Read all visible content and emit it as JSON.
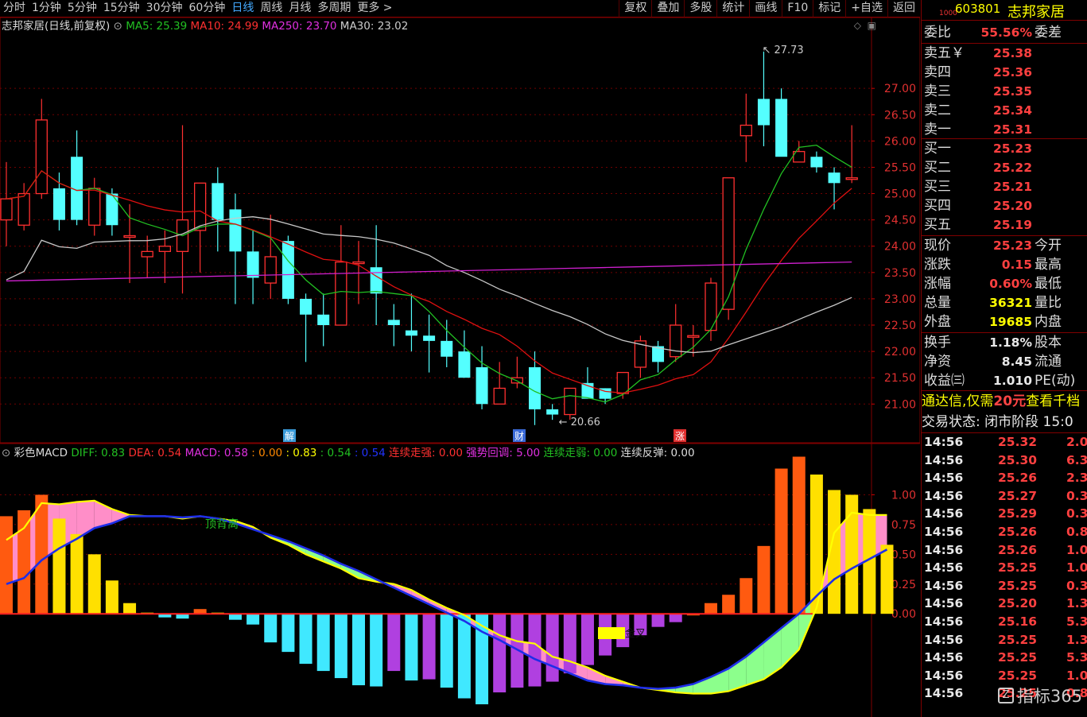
{
  "toolbar": {
    "periods": [
      "分时",
      "1分钟",
      "5分钟",
      "15分钟",
      "30分钟",
      "60分钟",
      "日线",
      "周线",
      "月线",
      "多周期",
      "更多 >"
    ],
    "active_period": "日线",
    "tools": [
      "复权",
      "叠加",
      "多股",
      "统计",
      "画线",
      "F10",
      "标记",
      "+自选",
      "返回"
    ]
  },
  "main_title": {
    "stock": "志邦家居(日线,前复权)",
    "ma5": "MA5: 25.39",
    "ma10": "MA10: 24.99",
    "ma250": "MA250: 23.70",
    "ma30": "MA30: 23.02"
  },
  "macd_title": {
    "name": "彩色MACD",
    "diff": "DIFF: 0.83",
    "dea": "DEA: 0.54",
    "macd": "MACD: 0.58",
    "v1": ": 0.00",
    "v2": ": 0.83",
    "v3": ": 0.54",
    "v4": ": 0.54",
    "s1": "连续走强: 0.00",
    "s2": "强势回调: 5.00",
    "s3": "连续走弱: 0.00",
    "s4": "连续反弹: 0.00"
  },
  "annotations": {
    "high": "27.73",
    "low": "20.66",
    "markers": [
      "解",
      "财",
      "涨"
    ],
    "divergence": "顶背离",
    "golden_cross": "低位金叉"
  },
  "colors": {
    "up": "#ff3030",
    "down": "#54ffff",
    "ma5": "#22c022",
    "ma10": "#e01010",
    "ma250": "#d020d0",
    "ma30": "#c8c8c8",
    "diff": "#ffff00",
    "dea": "#1e2ee8"
  },
  "chart_data": [
    {
      "type": "candlestick",
      "title": "志邦家居(日线,前复权)",
      "yticks": [
        21.0,
        21.5,
        22.0,
        22.5,
        23.0,
        23.5,
        24.0,
        24.5,
        25.0,
        25.5,
        26.0,
        26.5,
        27.0
      ],
      "ylim": [
        20.4,
        28.0
      ],
      "candles": [
        [
          24.5,
          24.9,
          24.0,
          25.6
        ],
        [
          24.4,
          25.0,
          24.3,
          25.2
        ],
        [
          25.0,
          26.4,
          24.9,
          26.8
        ],
        [
          25.1,
          24.5,
          24.3,
          25.4
        ],
        [
          25.7,
          24.5,
          24.4,
          26.2
        ],
        [
          24.4,
          25.1,
          24.2,
          25.3
        ],
        [
          25.0,
          24.4,
          24.2,
          25.1
        ],
        [
          24.2,
          24.2,
          23.3,
          24.8
        ],
        [
          23.8,
          23.9,
          23.4,
          24.2
        ],
        [
          23.9,
          24.0,
          23.3,
          24.3
        ],
        [
          23.9,
          24.5,
          23.1,
          26.3
        ],
        [
          24.3,
          25.2,
          23.5,
          25.2
        ],
        [
          25.2,
          24.5,
          23.9,
          25.5
        ],
        [
          24.7,
          23.9,
          22.9,
          25.0
        ],
        [
          23.9,
          23.4,
          22.9,
          24.3
        ],
        [
          23.3,
          23.8,
          23.0,
          24.6
        ],
        [
          24.1,
          23.0,
          22.9,
          24.2
        ],
        [
          23.0,
          22.7,
          21.8,
          23.1
        ],
        [
          22.7,
          22.5,
          22.1,
          23.1
        ],
        [
          22.5,
          23.7,
          22.5,
          24.4
        ],
        [
          23.7,
          23.7,
          22.9,
          24.1
        ],
        [
          23.6,
          23.1,
          22.5,
          24.4
        ],
        [
          22.6,
          22.5,
          22.1,
          22.9
        ],
        [
          22.4,
          22.3,
          22.0,
          23.1
        ],
        [
          22.3,
          22.2,
          21.6,
          22.7
        ],
        [
          22.2,
          21.9,
          21.7,
          22.6
        ],
        [
          22.0,
          21.5,
          21.5,
          22.4
        ],
        [
          21.7,
          21.0,
          20.9,
          22.1
        ],
        [
          21.0,
          21.3,
          21.1,
          21.8
        ],
        [
          21.4,
          21.5,
          21.3,
          21.9
        ],
        [
          21.7,
          20.9,
          20.6,
          22.0
        ],
        [
          20.9,
          20.8,
          20.7,
          21.0
        ],
        [
          20.8,
          21.3,
          20.7,
          21.3
        ],
        [
          21.4,
          21.1,
          21.2,
          21.7
        ],
        [
          21.3,
          21.1,
          21.0,
          21.3
        ],
        [
          21.2,
          21.6,
          21.1,
          21.6
        ],
        [
          21.7,
          22.2,
          21.5,
          22.3
        ],
        [
          22.1,
          21.8,
          21.6,
          22.2
        ],
        [
          21.9,
          22.5,
          21.8,
          22.9
        ],
        [
          22.3,
          22.3,
          21.9,
          22.5
        ],
        [
          22.4,
          23.3,
          22.2,
          23.4
        ],
        [
          22.8,
          25.3,
          22.6,
          25.3
        ],
        [
          26.1,
          26.3,
          25.6,
          26.9
        ],
        [
          26.8,
          26.3,
          25.9,
          27.7
        ],
        [
          26.8,
          25.7,
          25.9,
          27.0
        ],
        [
          25.6,
          25.8,
          25.6,
          26.0
        ],
        [
          25.7,
          25.5,
          25.4,
          25.8
        ],
        [
          25.4,
          25.2,
          24.7,
          25.5
        ],
        [
          25.3,
          25.3,
          25.2,
          26.3
        ]
      ]
    },
    {
      "type": "bar",
      "title": "彩色MACD",
      "yticks": [
        0.0,
        0.25,
        0.5,
        0.75,
        1.0
      ],
      "macd": [
        0.82,
        0.87,
        1.0,
        0.8,
        0.67,
        0.5,
        0.28,
        0.09,
        0.01,
        -0.03,
        -0.04,
        0.04,
        0.01,
        -0.05,
        -0.09,
        -0.24,
        -0.32,
        -0.42,
        -0.48,
        -0.54,
        -0.6,
        -0.61,
        -0.48,
        -0.56,
        -0.55,
        -0.62,
        -0.71,
        -0.76,
        -0.66,
        -0.62,
        -0.61,
        -0.57,
        -0.5,
        -0.43,
        -0.35,
        -0.28,
        -0.18,
        -0.11,
        -0.07,
        0.0,
        0.09,
        0.16,
        0.3,
        0.57,
        1.22,
        1.32,
        1.17,
        1.04,
        1.0,
        0.88,
        0.58
      ],
      "diff": [
        0.62,
        0.72,
        0.93,
        0.92,
        0.94,
        0.95,
        0.88,
        0.83,
        0.82,
        0.82,
        0.8,
        0.82,
        0.8,
        0.78,
        0.73,
        0.64,
        0.58,
        0.5,
        0.44,
        0.38,
        0.3,
        0.27,
        0.25,
        0.2,
        0.12,
        0.05,
        -0.01,
        -0.1,
        -0.18,
        -0.23,
        -0.25,
        -0.36,
        -0.4,
        -0.45,
        -0.52,
        -0.57,
        -0.62,
        -0.64,
        -0.66,
        -0.67,
        -0.67,
        -0.65,
        -0.6,
        -0.55,
        -0.45,
        -0.3,
        0.05,
        0.68,
        0.85,
        0.83,
        0.83
      ],
      "dea": [
        0.25,
        0.3,
        0.45,
        0.55,
        0.63,
        0.72,
        0.76,
        0.82,
        0.82,
        0.82,
        0.81,
        0.82,
        0.8,
        0.76,
        0.71,
        0.66,
        0.61,
        0.55,
        0.49,
        0.42,
        0.36,
        0.29,
        0.22,
        0.15,
        0.08,
        0.01,
        -0.06,
        -0.15,
        -0.22,
        -0.3,
        -0.38,
        -0.44,
        -0.5,
        -0.56,
        -0.59,
        -0.6,
        -0.62,
        -0.63,
        -0.62,
        -0.59,
        -0.53,
        -0.46,
        -0.36,
        -0.24,
        -0.12,
        0.0,
        0.15,
        0.29,
        0.38,
        0.46,
        0.54
      ]
    }
  ],
  "quote_panel": {
    "small_label": "1000",
    "code": "603801",
    "name": "志邦家居",
    "weibi_label": "委比",
    "weibi_val": "55.56%",
    "weicha_label": "委差",
    "asks": [
      {
        "label": "卖五￥",
        "price": "25.38"
      },
      {
        "label": "卖四",
        "price": "25.36"
      },
      {
        "label": "卖三",
        "price": "25.35"
      },
      {
        "label": "卖二",
        "price": "25.34"
      },
      {
        "label": "卖一",
        "price": "25.31"
      }
    ],
    "bids": [
      {
        "label": "买一",
        "price": "25.23"
      },
      {
        "label": "买二",
        "price": "25.22"
      },
      {
        "label": "买三",
        "price": "25.21"
      },
      {
        "label": "买四",
        "price": "25.20"
      },
      {
        "label": "买五",
        "price": "25.19"
      }
    ],
    "stats1": [
      {
        "label": "现价",
        "val": "25.23",
        "label2": "今开"
      },
      {
        "label": "涨跌",
        "val": "0.15",
        "label2": "最高"
      },
      {
        "label": "涨幅",
        "val": "0.60%",
        "label2": "最低"
      },
      {
        "label": "总量",
        "val": "36321",
        "label2": "量比"
      },
      {
        "label": "外盘",
        "val": "19685",
        "label2": "内盘"
      }
    ],
    "stats2": [
      {
        "label": "换手",
        "val": "1.18%",
        "label2": "股本"
      },
      {
        "label": "净资",
        "val": "8.45",
        "label2": "流通"
      },
      {
        "label": "收益㈢",
        "val": "1.010",
        "label2": "PE(动)"
      }
    ],
    "promo": "通达信,仅需",
    "promo_price": "20元",
    "promo_tail": "查看千档",
    "trade_state": "交易状态: 闭市阶段",
    "trade_time": "15:0",
    "ticks": [
      {
        "time": "14:56",
        "price": "25.32",
        "vol": "2.0"
      },
      {
        "time": "14:56",
        "price": "25.30",
        "vol": "6.3"
      },
      {
        "time": "14:56",
        "price": "25.26",
        "vol": "2.3"
      },
      {
        "time": "14:56",
        "price": "25.27",
        "vol": "0.3"
      },
      {
        "time": "14:56",
        "price": "25.29",
        "vol": "0.3"
      },
      {
        "time": "14:56",
        "price": "25.26",
        "vol": "0.8"
      },
      {
        "time": "14:56",
        "price": "25.26",
        "vol": "1.0"
      },
      {
        "time": "14:56",
        "price": "25.25",
        "vol": "1.0"
      },
      {
        "time": "14:56",
        "price": "25.25",
        "vol": "0.3"
      },
      {
        "time": "14:56",
        "price": "25.20",
        "vol": "1.3"
      },
      {
        "time": "14:56",
        "price": "25.16",
        "vol": "5.3"
      },
      {
        "time": "14:56",
        "price": "25.25",
        "vol": "1.3"
      },
      {
        "time": "14:56",
        "price": "25.25",
        "vol": "5.3"
      },
      {
        "time": "14:56",
        "price": "25.25",
        "vol": "1.0"
      },
      {
        "time": "14:56",
        "price": "25.25",
        "vol": "0.8"
      }
    ],
    "watermark": "指标365"
  }
}
